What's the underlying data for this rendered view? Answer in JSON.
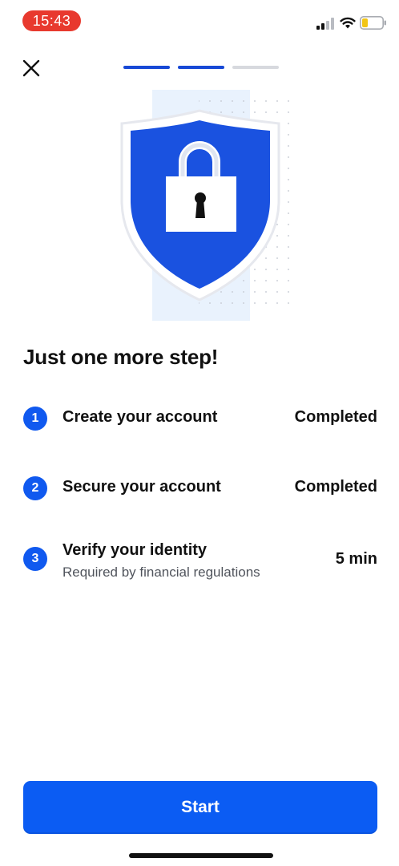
{
  "status_bar": {
    "time": "15:43",
    "signal_icon": "cellular-signal-icon",
    "wifi_icon": "wifi-icon",
    "battery_icon": "battery-low-icon",
    "time_pill_color": "#e8392e"
  },
  "header": {
    "close_icon": "close-icon",
    "progress": {
      "total_steps": 3,
      "completed_steps": 2
    }
  },
  "illustration": {
    "icon": "shield-lock-icon",
    "accent": "#1749d6"
  },
  "title": "Just one more step!",
  "steps": [
    {
      "number": "1",
      "label": "Create your account",
      "subtitle": "",
      "status": "Completed"
    },
    {
      "number": "2",
      "label": "Secure your account",
      "subtitle": "",
      "status": "Completed"
    },
    {
      "number": "3",
      "label": "Verify your identity",
      "subtitle": "Required by financial regulations",
      "status": "5 min"
    }
  ],
  "start_button": {
    "label": "Start",
    "color": "#0b5cf3"
  }
}
